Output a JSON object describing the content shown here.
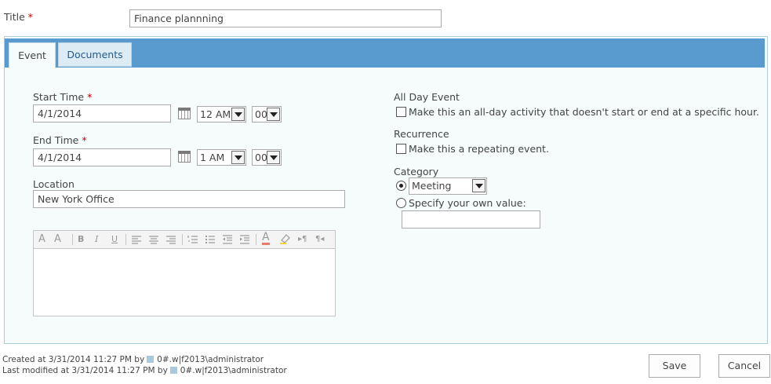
{
  "title_field": {
    "label": "Title",
    "required": "*",
    "value": "Finance plannning"
  },
  "tabs": [
    {
      "label": "Event",
      "active": true
    },
    {
      "label": "Documents",
      "active": false
    }
  ],
  "colors": {
    "accent": "#5a9bcf",
    "panel_bg": "#f6fbfb",
    "required": "#bf0000"
  },
  "start_time": {
    "label": "Start Time",
    "required": "*",
    "date": "4/1/2014",
    "hour": "12 AM",
    "minute": "00"
  },
  "end_time": {
    "label": "End Time",
    "required": "*",
    "date": "4/1/2014",
    "hour": "1 AM",
    "minute": "00"
  },
  "location": {
    "label": "Location",
    "value": "New York Office"
  },
  "editor": {
    "toolbar_icons": [
      "font-size-icon",
      "clear-format-icon",
      "bold-icon",
      "italic-icon",
      "underline-icon",
      "align-left-icon",
      "align-center-icon",
      "align-right-icon",
      "numbered-list-icon",
      "bullet-list-icon",
      "outdent-icon",
      "indent-icon",
      "text-color-icon",
      "highlight-icon",
      "ltr-icon",
      "rtl-icon"
    ],
    "toolbar_glyphs": {
      "font": "A",
      "clear": "A",
      "bold": "B",
      "italic": "I",
      "underline": "U",
      "color": "A",
      "ltr": "¶",
      "rtl": "¶"
    },
    "value": ""
  },
  "all_day": {
    "label": "All Day Event",
    "checkbox_label": "Make this an all-day activity that doesn't start or end at a specific hour.",
    "checked": false
  },
  "recurrence": {
    "label": "Recurrence",
    "checkbox_label": "Make this a repeating event.",
    "checked": false
  },
  "category": {
    "label": "Category",
    "selected": "Meeting",
    "own_value_label": "Specify your own value:",
    "own_value": ""
  },
  "footer": {
    "created_prefix": "Created at 3/31/2014 11:27 PM by",
    "created_user": "0#.w|f2013\\administrator",
    "modified_prefix": "Last modified at 3/31/2014 11:27 PM by",
    "modified_user": "0#.w|f2013\\administrator",
    "save_label": "Save",
    "cancel_label": "Cancel"
  }
}
